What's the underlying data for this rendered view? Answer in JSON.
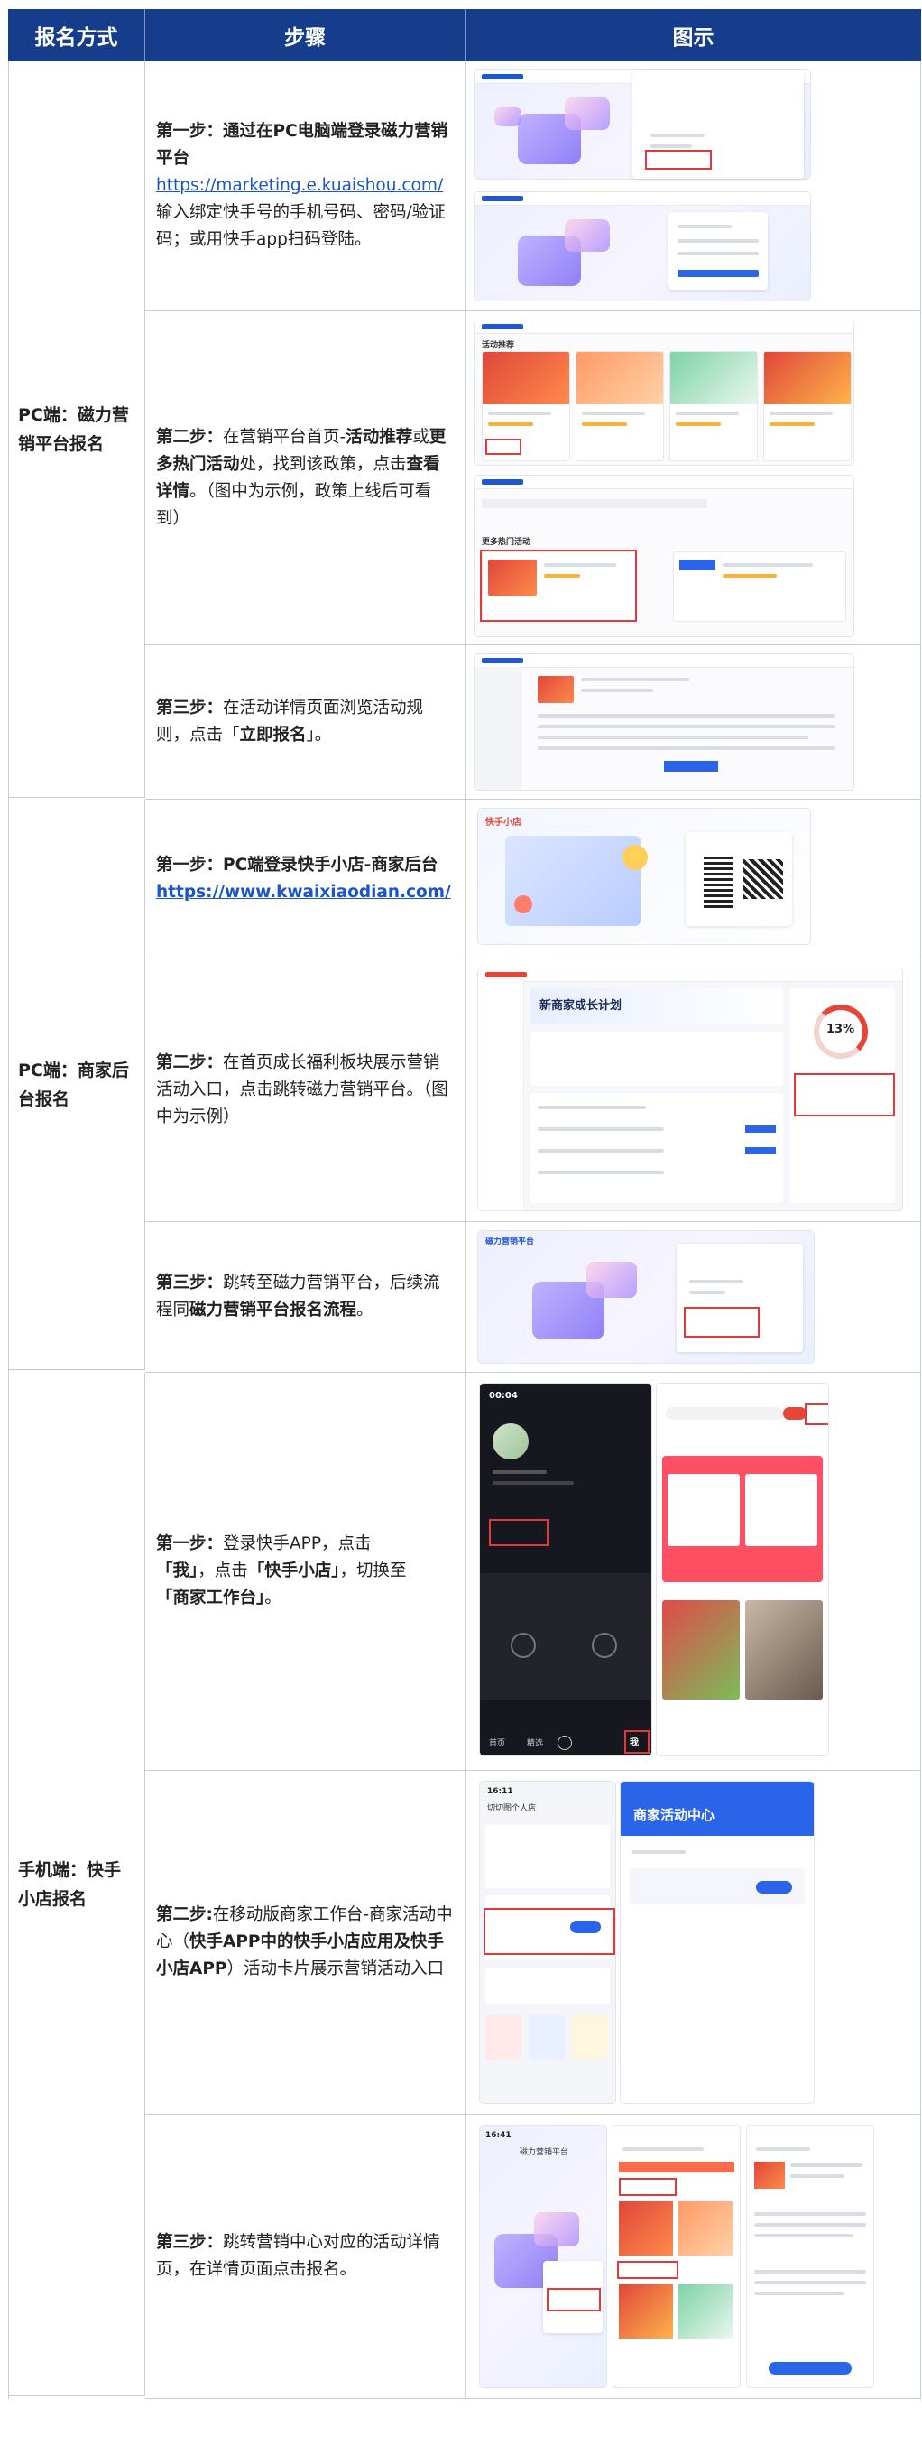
{
  "header": {
    "col_method": "报名方式",
    "col_steps": "步骤",
    "col_illustration": "图示"
  },
  "groups": [
    {
      "method": "PC端：磁力营销平台报名",
      "steps": [
        {
          "lead": "第一步：",
          "bold": "通过在PC电脑端登录磁力营销平台",
          "link": "https://marketing.e.kuaishou.com/",
          "rest": "输入绑定快手号的手机号码、密码/验证码；或用快手app扫码登陆。"
        },
        {
          "lead": "第二步：",
          "t1": "在营销平台首页-",
          "b1": "活动推荐",
          "t2": "或",
          "b2": "更多热门活动",
          "t3": "处，找到该政策，点击",
          "b3": "查看详情",
          "t4": "。（图中为示例，政策上线后可看到）"
        },
        {
          "lead": "第三步：",
          "t1": "在活动详情页面浏览活动规则，点击「",
          "b1": "立即报名",
          "t2": "」。"
        }
      ]
    },
    {
      "method": "PC端：商家后台报名",
      "steps": [
        {
          "lead": "第一步：",
          "bold": "PC端登录快手小店-商家后台",
          "link": "https://www.kwaixiaodian.com/"
        },
        {
          "lead": "第二步：",
          "t1": "在首页成长福利板块展示营销活动入口，点击跳转磁力营销平台。（图中为示例）"
        },
        {
          "lead": "第三步：",
          "t1": "跳转至磁力营销平台，后续流程同",
          "b1": "磁力营销平台报名流程",
          "t2": "。"
        }
      ]
    },
    {
      "method": "手机端：快手小店报名",
      "steps": [
        {
          "lead": "第一步：",
          "t1": "登录快手APP，点击",
          "b1": "「我」",
          "t2": "，点击",
          "b2": "「快手小店」",
          "t3": "，切换至",
          "b3": "「商家工作台」",
          "t4": "。"
        },
        {
          "lead": "第二步:",
          "t1": "在移动版商家工作台-商家活动中心（",
          "b1": "快手APP中的快手小店应用及快手小店APP",
          "t2": "）活动卡片展示营销活动入口"
        },
        {
          "lead": "第三步：",
          "t1": "跳转营销中心对应的活动详情页，在详情页面点击报名。"
        }
      ]
    }
  ],
  "illustrations": {
    "brand_mag": "磁力营销平台",
    "brand_shop": "快手小店",
    "recommend": "活动推荐",
    "hot_more": "更多热门活动",
    "growth_plan": "新商家成长计划",
    "percent": "13%",
    "phone_time": "00:04",
    "tab_me": "我",
    "tab_home": "首页",
    "tab_choice": "精选",
    "phone_time2": "16:11",
    "workbench": "切切图个人店",
    "activity_center": "商家活动中心",
    "phone_time3": "16:41",
    "mag_mobile": "磁力营销平台"
  },
  "colors": {
    "header_bg": "#163c8c",
    "link": "#1a56c9",
    "highlight": "#e23a3a"
  }
}
